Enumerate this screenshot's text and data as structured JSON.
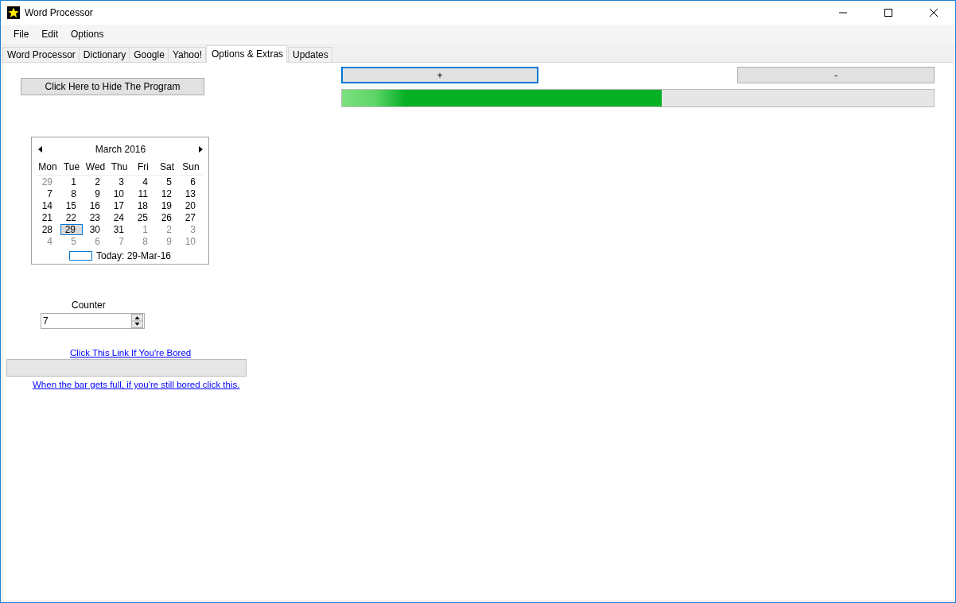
{
  "window": {
    "title": "Word Processor"
  },
  "menu": [
    "File",
    "Edit",
    "Options"
  ],
  "tabs": [
    {
      "label": "Word Processor",
      "selected": false
    },
    {
      "label": "Dictionary",
      "selected": false
    },
    {
      "label": "Google",
      "selected": false
    },
    {
      "label": "Yahoo!",
      "selected": false
    },
    {
      "label": "Options & Extras",
      "selected": true
    },
    {
      "label": "Updates",
      "selected": false
    }
  ],
  "hide_button": "Click Here to Hide The Program",
  "calendar": {
    "month": "March 2016",
    "weekdays": [
      "Mon",
      "Tue",
      "Wed",
      "Thu",
      "Fri",
      "Sat",
      "Sun"
    ],
    "weeks": [
      [
        {
          "label": "29",
          "muted": true,
          "selected": false
        },
        {
          "label": "1",
          "muted": false,
          "selected": false
        },
        {
          "label": "2",
          "muted": false,
          "selected": false
        },
        {
          "label": "3",
          "muted": false,
          "selected": false
        },
        {
          "label": "4",
          "muted": false,
          "selected": false
        },
        {
          "label": "5",
          "muted": false,
          "selected": false
        },
        {
          "label": "6",
          "muted": false,
          "selected": false
        }
      ],
      [
        {
          "label": "7",
          "muted": false,
          "selected": false
        },
        {
          "label": "8",
          "muted": false,
          "selected": false
        },
        {
          "label": "9",
          "muted": false,
          "selected": false
        },
        {
          "label": "10",
          "muted": false,
          "selected": false
        },
        {
          "label": "11",
          "muted": false,
          "selected": false
        },
        {
          "label": "12",
          "muted": false,
          "selected": false
        },
        {
          "label": "13",
          "muted": false,
          "selected": false
        }
      ],
      [
        {
          "label": "14",
          "muted": false,
          "selected": false
        },
        {
          "label": "15",
          "muted": false,
          "selected": false
        },
        {
          "label": "16",
          "muted": false,
          "selected": false
        },
        {
          "label": "17",
          "muted": false,
          "selected": false
        },
        {
          "label": "18",
          "muted": false,
          "selected": false
        },
        {
          "label": "19",
          "muted": false,
          "selected": false
        },
        {
          "label": "20",
          "muted": false,
          "selected": false
        }
      ],
      [
        {
          "label": "21",
          "muted": false,
          "selected": false
        },
        {
          "label": "22",
          "muted": false,
          "selected": false
        },
        {
          "label": "23",
          "muted": false,
          "selected": false
        },
        {
          "label": "24",
          "muted": false,
          "selected": false
        },
        {
          "label": "25",
          "muted": false,
          "selected": false
        },
        {
          "label": "26",
          "muted": false,
          "selected": false
        },
        {
          "label": "27",
          "muted": false,
          "selected": false
        }
      ],
      [
        {
          "label": "28",
          "muted": false,
          "selected": false
        },
        {
          "label": "29",
          "muted": false,
          "selected": true
        },
        {
          "label": "30",
          "muted": false,
          "selected": false
        },
        {
          "label": "31",
          "muted": false,
          "selected": false
        },
        {
          "label": "1",
          "muted": true,
          "selected": false
        },
        {
          "label": "2",
          "muted": true,
          "selected": false
        },
        {
          "label": "3",
          "muted": true,
          "selected": false
        }
      ],
      [
        {
          "label": "4",
          "muted": true,
          "selected": false
        },
        {
          "label": "5",
          "muted": true,
          "selected": false
        },
        {
          "label": "6",
          "muted": true,
          "selected": false
        },
        {
          "label": "7",
          "muted": true,
          "selected": false
        },
        {
          "label": "8",
          "muted": true,
          "selected": false
        },
        {
          "label": "9",
          "muted": true,
          "selected": false
        },
        {
          "label": "10",
          "muted": true,
          "selected": false
        }
      ]
    ],
    "today": "Today: 29-Mar-16"
  },
  "counter": {
    "label": "Counter",
    "value": "7"
  },
  "bored_link": "Click This Link If You're Bored",
  "bored_bar": {
    "level": 0
  },
  "full_link": "When the bar gets full, if you're still bored click this.",
  "plus_button": {
    "label": "+",
    "focused": true
  },
  "minus_button": {
    "label": "-",
    "focused": false
  },
  "progress": {
    "level": 0.54
  }
}
